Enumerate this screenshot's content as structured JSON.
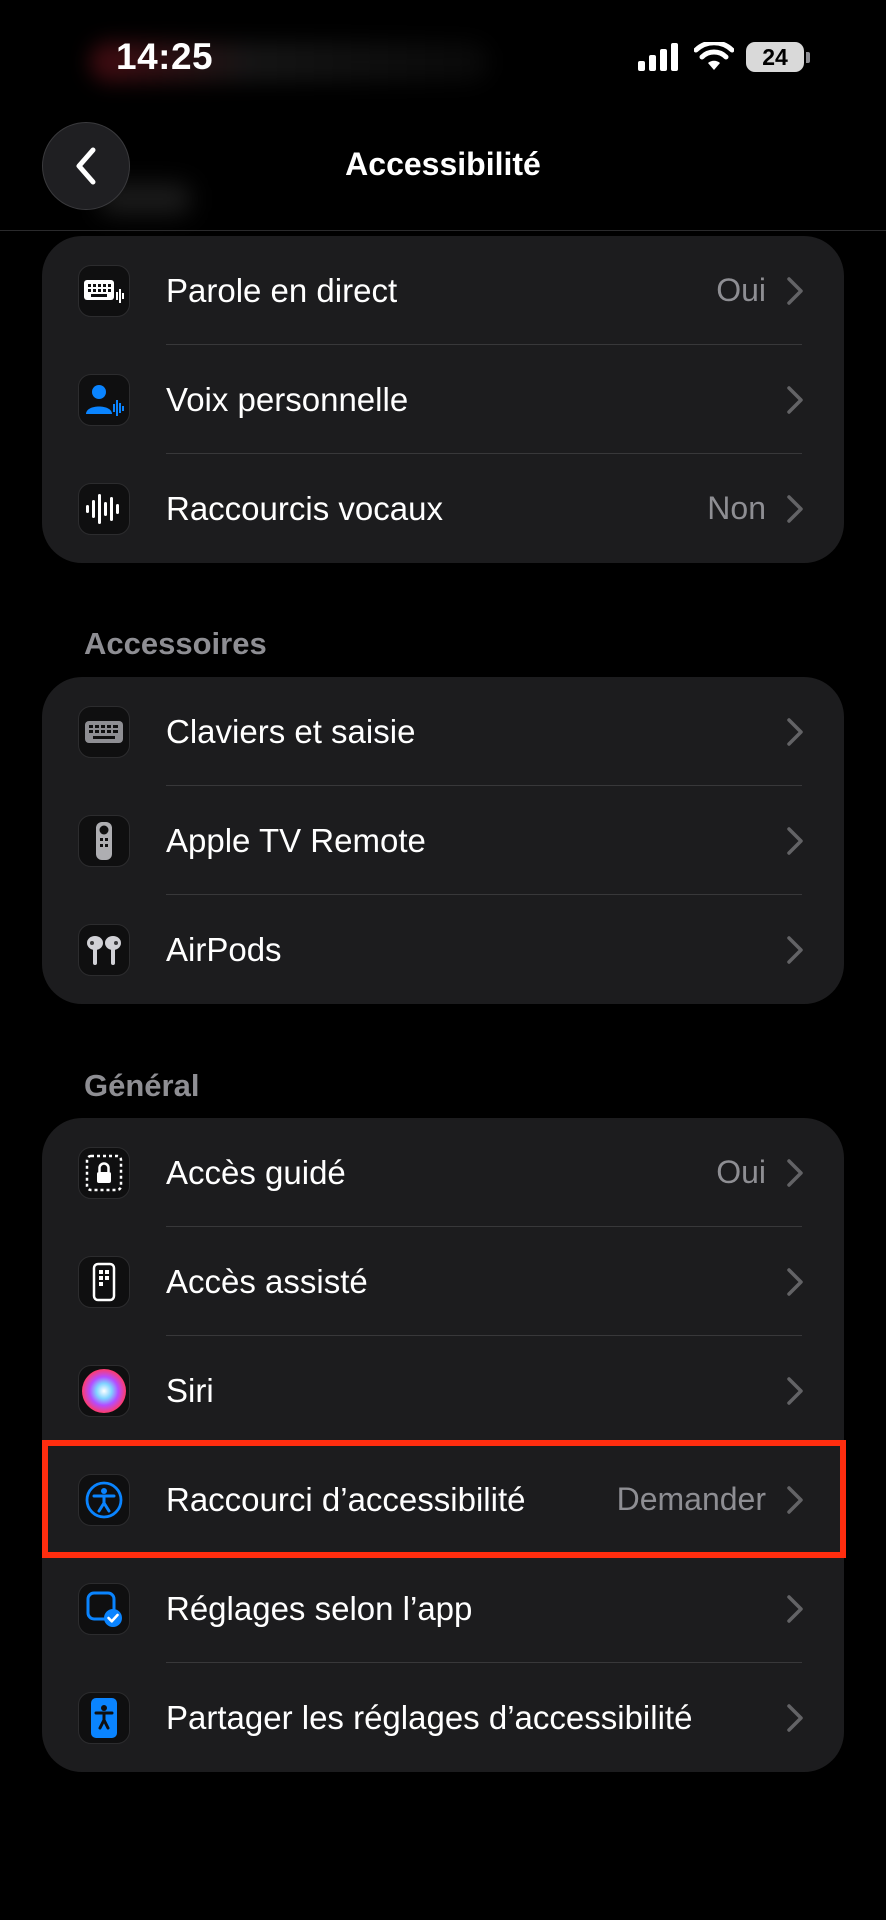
{
  "status_bar": {
    "time": "14:25",
    "battery": "24",
    "icons": [
      "cellular-signal-icon",
      "wifi-icon",
      "battery-icon"
    ]
  },
  "nav": {
    "title": "Accessibilité",
    "back_icon": "chevron-left-icon"
  },
  "groups": {
    "speech": {
      "items": [
        {
          "label": "Parole en direct",
          "value": "Oui",
          "icon": "keyboard-waveform-icon"
        },
        {
          "label": "Voix personnelle",
          "value": "",
          "icon": "person-waveform-icon"
        },
        {
          "label": "Raccourcis vocaux",
          "value": "Non",
          "icon": "waveform-icon"
        }
      ]
    },
    "accessories": {
      "header": "Accessoires",
      "items": [
        {
          "label": "Claviers et saisie",
          "value": "",
          "icon": "keyboard-icon"
        },
        {
          "label": "Apple TV Remote",
          "value": "",
          "icon": "tv-remote-icon"
        },
        {
          "label": "AirPods",
          "value": "",
          "icon": "airpods-icon"
        }
      ]
    },
    "general": {
      "header": "Général",
      "items": [
        {
          "label": "Accès guidé",
          "value": "Oui",
          "icon": "guided-access-lock-icon"
        },
        {
          "label": "Accès assisté",
          "value": "",
          "icon": "assistive-access-phone-icon"
        },
        {
          "label": "Siri",
          "value": "",
          "icon": "siri-icon"
        },
        {
          "label": "Raccourci d’accessibilité",
          "value": "Demander",
          "icon": "accessibility-icon"
        },
        {
          "label": "Réglages selon l’app",
          "value": "",
          "icon": "per-app-settings-icon"
        },
        {
          "label": "Partager les réglages d’accessibilité",
          "value": "",
          "icon": "share-accessibility-icon"
        }
      ]
    }
  },
  "colors": {
    "background": "#000000",
    "card": "#1c1c1e",
    "secondary_text": "#8e8e93",
    "accent_blue": "#0a84ff",
    "highlight_red": "#ff2d0f"
  }
}
